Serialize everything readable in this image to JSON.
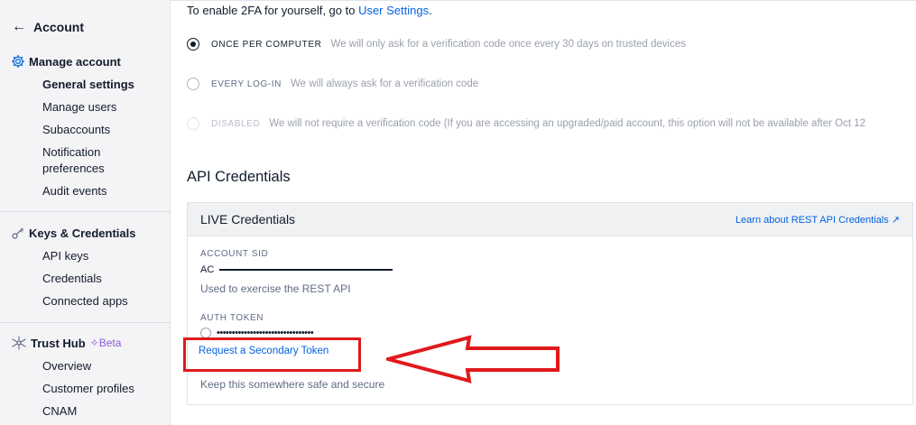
{
  "sidebar": {
    "back_label": "Account",
    "sections": [
      {
        "title": "Manage account",
        "icon": "gear-icon",
        "items": [
          {
            "label": "General settings",
            "active": true
          },
          {
            "label": "Manage users"
          },
          {
            "label": "Subaccounts"
          },
          {
            "label": "Notification preferences"
          },
          {
            "label": "Audit events"
          }
        ]
      },
      {
        "title": "Keys & Credentials",
        "icon": "key-icon",
        "items": [
          {
            "label": "API keys"
          },
          {
            "label": "Credentials"
          },
          {
            "label": "Connected apps"
          }
        ]
      },
      {
        "title": "Trust Hub",
        "badge": "Beta",
        "icon": "network-icon",
        "items": [
          {
            "label": "Overview"
          },
          {
            "label": "Customer profiles"
          },
          {
            "label": "CNAM"
          }
        ]
      }
    ]
  },
  "twofa": {
    "intro_prefix": "To enable 2FA for yourself, go to ",
    "intro_link": "User Settings",
    "intro_suffix": ".",
    "options": [
      {
        "label": "ONCE PER COMPUTER",
        "desc": "We will only ask for a verification code once every 30 days on trusted devices",
        "checked": true
      },
      {
        "label": "EVERY LOG-IN",
        "desc": "We will always ask for a verification code",
        "checked": false
      },
      {
        "label": "DISABLED",
        "desc": "We will not require a verification code (If you are accessing an upgraded/paid account, this option will not be available after Oct 12",
        "checked": false,
        "disabled": true
      }
    ]
  },
  "api": {
    "title": "API Credentials",
    "card_title": "LIVE Credentials",
    "card_link": "Learn about REST API Credentials ↗",
    "sid_label": "ACCOUNT SID",
    "sid_value": "AC",
    "sid_note": "Used to exercise the REST API",
    "token_label": "AUTH TOKEN",
    "token_value": "••••••••••••••••••••••••••••••••",
    "request_link": "Request a Secondary Token",
    "token_note": "Keep this somewhere safe and secure"
  },
  "colors": {
    "link": "#0263e0",
    "highlight": "#e0191c",
    "beta": "#8c5bd8"
  }
}
